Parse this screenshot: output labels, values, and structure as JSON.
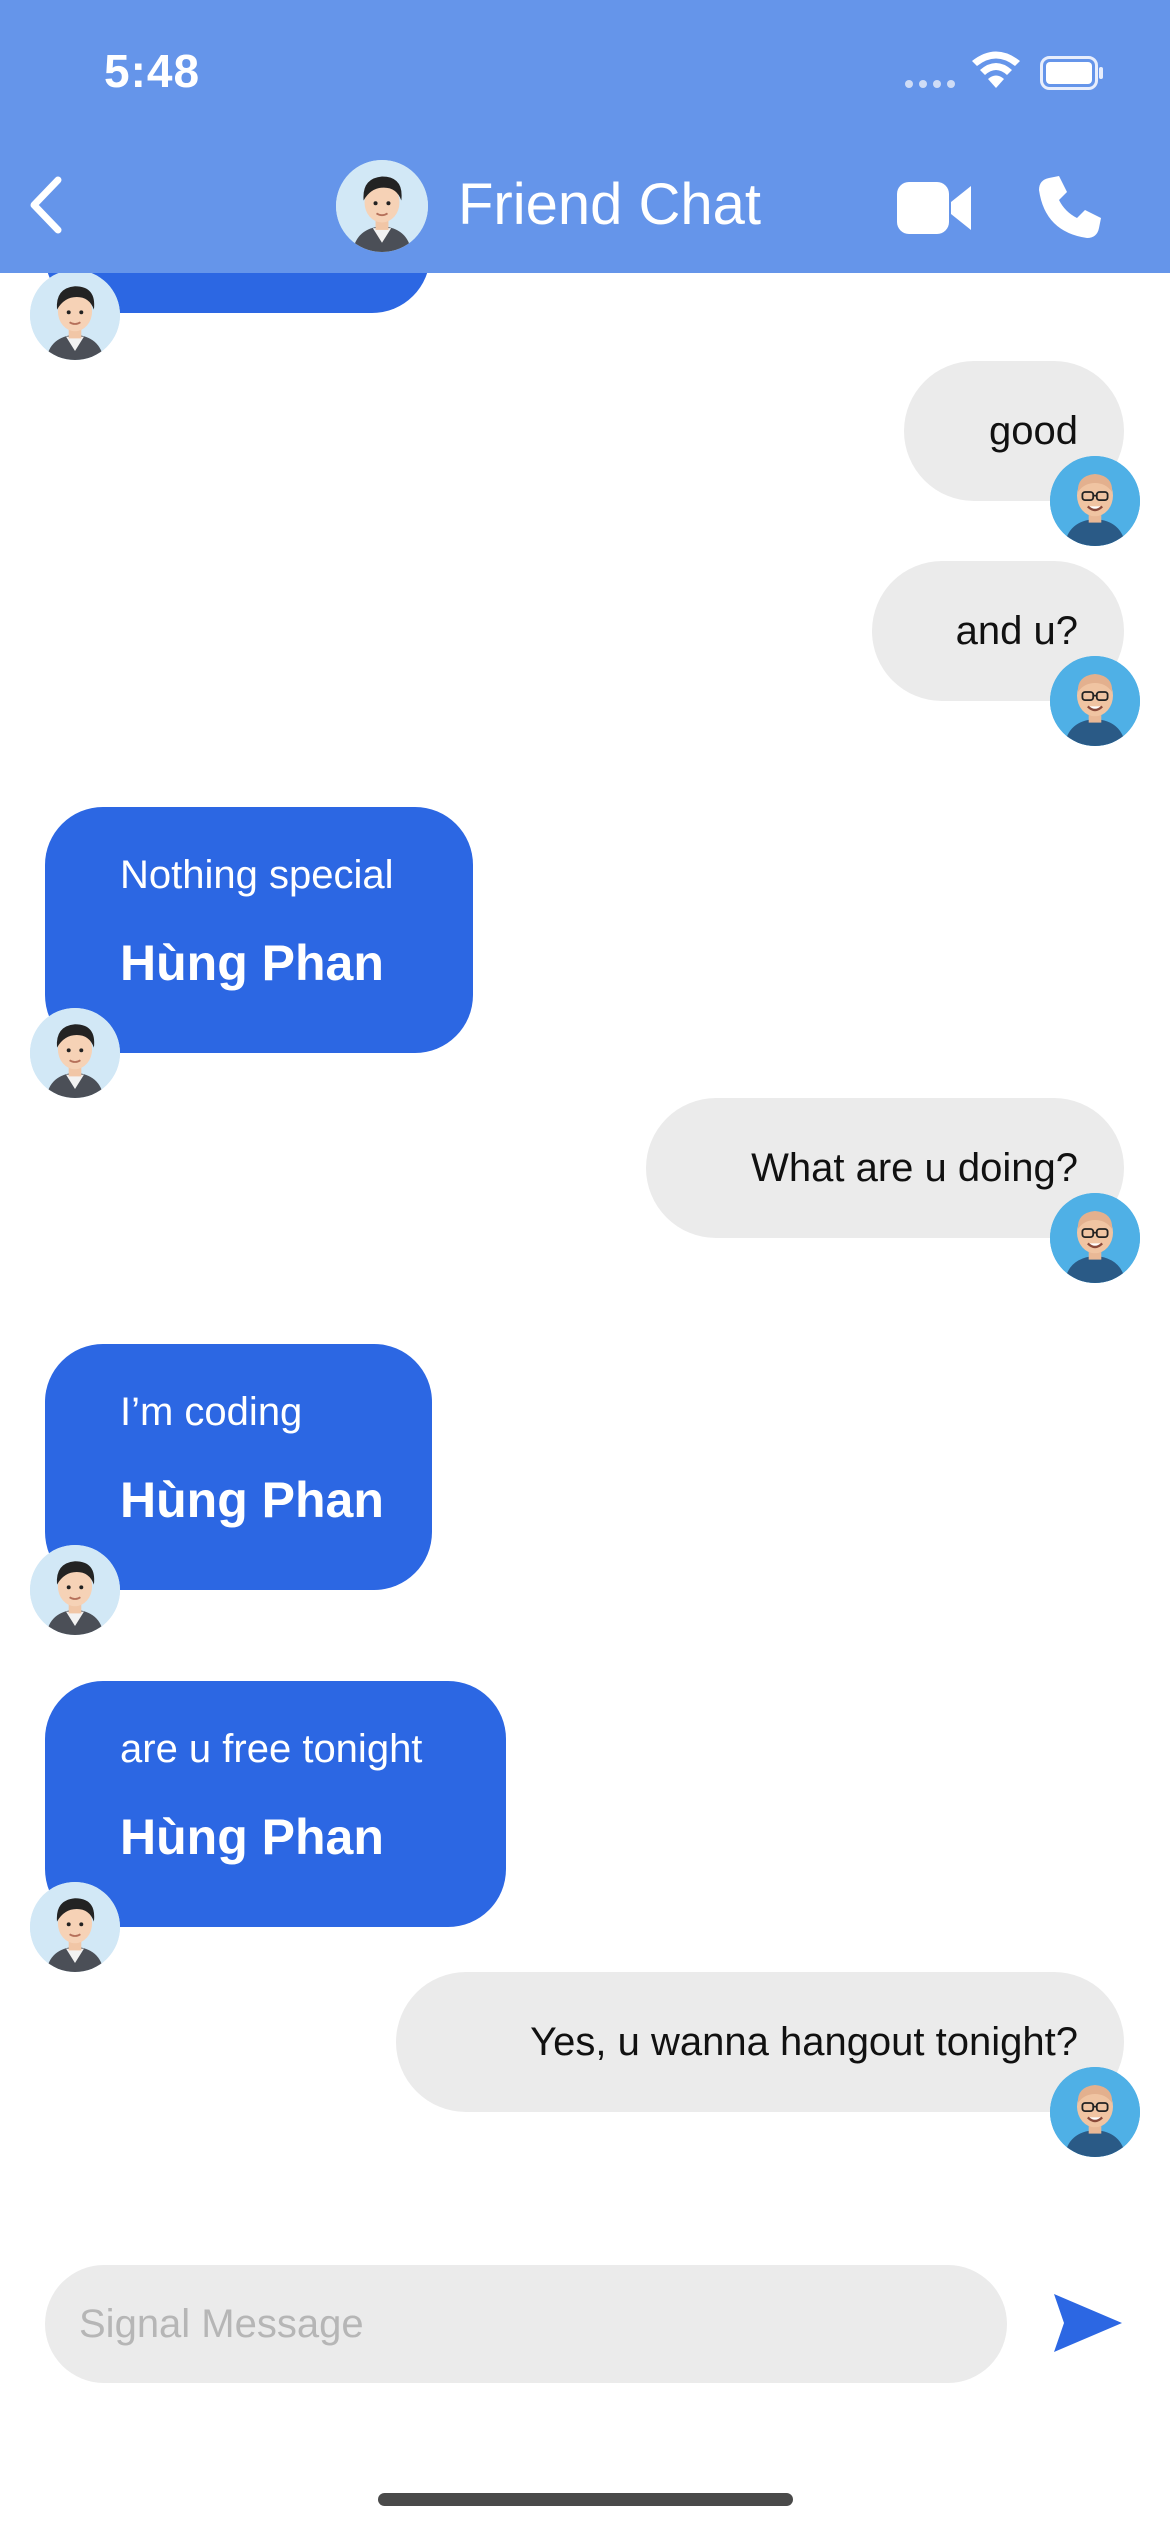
{
  "status_bar": {
    "time": "5:48"
  },
  "header": {
    "title": "Friend Chat"
  },
  "conversation": {
    "incoming_sender": "Hùng Phan",
    "out_1": "good",
    "out_2": "and u?",
    "in_1": "Nothing special",
    "out_3": "What are u doing?",
    "in_2": "I’m coding",
    "in_3": "are u free tonight",
    "out_4": "Yes, u wanna hangout tonight?"
  },
  "composer": {
    "placeholder": "Signal Message"
  },
  "colors": {
    "header_bg": "#6595ea",
    "incoming_bubble": "#2c67e3",
    "outgoing_bubble": "#ebebeb",
    "send_icon": "#2c67e3"
  },
  "icons": [
    "back-chevron-icon",
    "video-camera-icon",
    "phone-icon",
    "send-icon",
    "wifi-icon",
    "battery-icon"
  ]
}
